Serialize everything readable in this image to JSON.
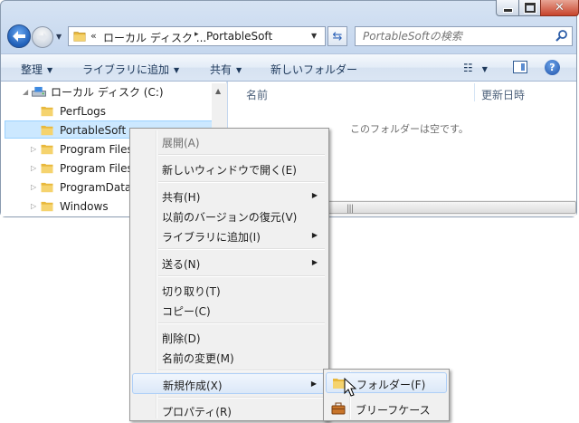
{
  "address": {
    "overflow_chevron": "«",
    "path_parts": [
      "ローカル ディスク ...",
      "PortableSoft"
    ],
    "separator": "▸"
  },
  "search": {
    "placeholder": "PortableSoftの検索"
  },
  "toolbar": {
    "organize": "整理",
    "add_to_library": "ライブラリに追加",
    "share": "共有",
    "new_folder": "新しいフォルダー"
  },
  "nav_tree": {
    "root": "ローカル ディスク (C:)",
    "items": [
      "PerfLogs",
      "PortableSoft",
      "Program Files",
      "Program Files",
      "ProgramData",
      "Windows"
    ],
    "selected": "PortableSoft"
  },
  "content": {
    "columns": [
      "名前",
      "更新日時"
    ],
    "empty_message": "このフォルダーは空です。"
  },
  "context_menu": {
    "expand": "展開(A)",
    "open_new_window": "新しいウィンドウで開く(E)",
    "share": "共有(H)",
    "restore_previous": "以前のバージョンの復元(V)",
    "add_to_library": "ライブラリに追加(I)",
    "send_to": "送る(N)",
    "cut": "切り取り(T)",
    "copy": "コピー(C)",
    "delete": "削除(D)",
    "rename": "名前の変更(M)",
    "new": "新規作成(X)",
    "properties": "プロパティ(R)"
  },
  "submenu": {
    "folder": "フォルダー(F)",
    "briefcase": "ブリーフケース"
  },
  "colors": {
    "accent": "#1e395b",
    "selection": "#cce8ff",
    "folder": "#e8b83c"
  }
}
